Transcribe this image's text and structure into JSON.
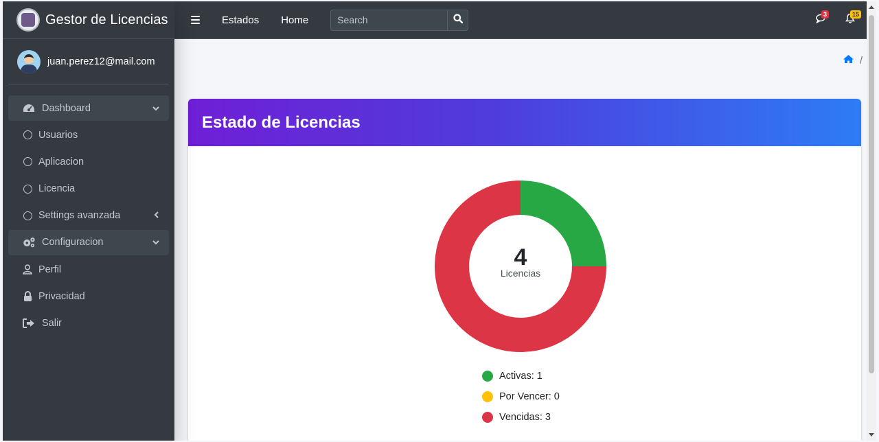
{
  "brand": {
    "name": "Gestor de Licencias"
  },
  "user": {
    "email": "juan.perez12@mail.com"
  },
  "sidebar": {
    "items": [
      {
        "label": "Dashboard"
      },
      {
        "label": "Usuarios"
      },
      {
        "label": "Aplicacion"
      },
      {
        "label": "Licencia"
      },
      {
        "label": "Settings avanzada"
      },
      {
        "label": "Configuracion"
      },
      {
        "label": "Perfil"
      },
      {
        "label": "Privacidad"
      },
      {
        "label": "Salir"
      }
    ]
  },
  "navbar": {
    "links": [
      "Estados",
      "Home"
    ],
    "search_placeholder": "Search",
    "messages_badge": "3",
    "notifications_badge": "15"
  },
  "breadcrumb": {
    "separator": "/"
  },
  "card": {
    "title": "Estado de Licencias"
  },
  "chart_data": {
    "type": "pie",
    "categories": [
      "Activas",
      "Por Vencer",
      "Vencidas"
    ],
    "values": [
      1,
      0,
      3
    ],
    "colors": [
      "#28a745",
      "#ffc107",
      "#dc3545"
    ],
    "center_value": "4",
    "center_label": "Licencias",
    "legend": [
      "Activas: 1",
      "Por Vencer: 0",
      "Vencidas: 3"
    ]
  }
}
